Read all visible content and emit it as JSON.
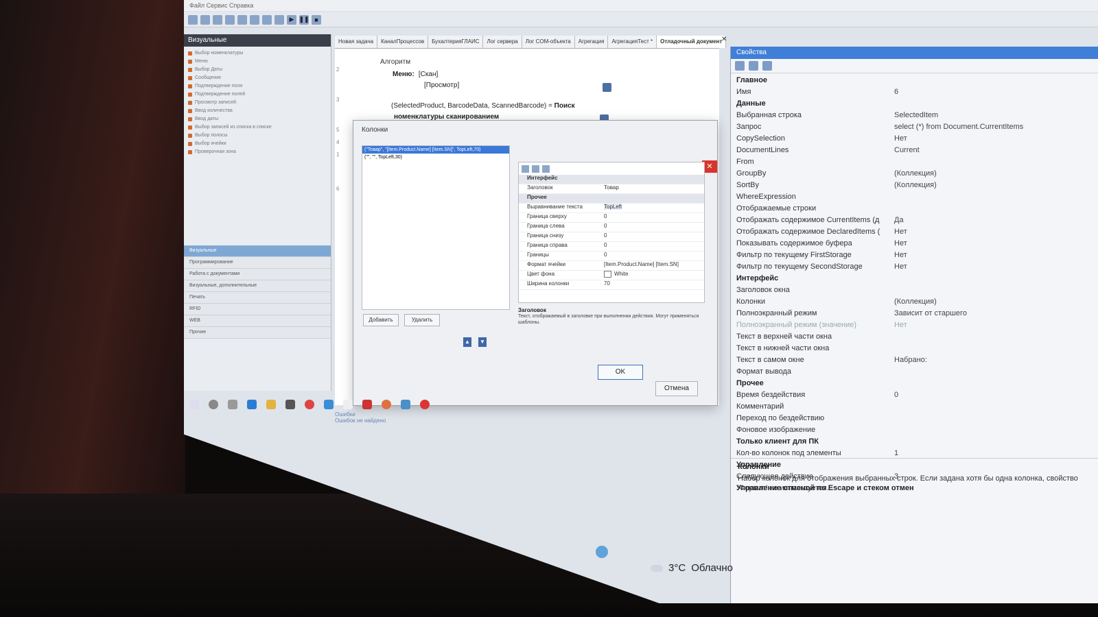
{
  "window": {
    "title": "Файл  Сервис  Справка"
  },
  "left_panel": {
    "header": "Визуальные",
    "items": [
      "Выбор номенклатуры",
      "Меню",
      "Выбор Даты",
      "Сообщение",
      "Подтверждение поля",
      "Подтверждение полей",
      "Просмотр записей",
      "Ввод количества",
      "Ввод даты",
      "Выбор записей из списка в списке",
      "Выбор полосы",
      "Выбор ячейки",
      "Проверочная зона"
    ],
    "sections": [
      "Визуальные",
      "Программирование",
      "Работа с документами",
      "Визуальные, дополнительные",
      "Печать",
      "RFID",
      "WEB",
      "Прочие"
    ]
  },
  "tabs": [
    "Новая задача",
    "КаналПроцессов",
    "БухалтерияГЛАИС",
    "Лог сервера",
    "Лог COM-объекта",
    "Агрегация",
    "АгрегацияТест *",
    "Отладочный документ"
  ],
  "editor": {
    "lines": [
      "2",
      "3",
      "5",
      "4",
      "1",
      "6"
    ],
    "algo": "Алгоритм",
    "menu_label": "Меню:",
    "menu_value1": "[Скан]",
    "menu_value2": "[Просмотр]",
    "assign_expr": "(SelectedProduct, BarcodeData, ScannedBarcode) =",
    "assign_op": "Поиск",
    "assign_line2": "номенклатуры сканированием"
  },
  "errors": {
    "title": "Ошибки",
    "line": "Ошибок не найдено"
  },
  "dialog": {
    "title": "Колонки",
    "list_items": [
      "(\"Товар\", \"[Item.Product.Name] [Item.SN]\", TopLeft,70)",
      "(\"\", \"\", TopLeft,30)"
    ],
    "add_label": "Добавить",
    "remove_label": "Удалить",
    "grid": {
      "rows": [
        {
          "k": "Интерфейс",
          "v": "",
          "cat": true
        },
        {
          "k": "Заголовок",
          "v": "Товар",
          "cat": false
        },
        {
          "k": "Прочее",
          "v": "",
          "cat": true
        },
        {
          "k": "Выравнивание текста",
          "v": "TopLeft",
          "cat": false
        },
        {
          "k": "Граница сверху",
          "v": "0",
          "cat": false
        },
        {
          "k": "Граница слева",
          "v": "0",
          "cat": false
        },
        {
          "k": "Граница снизу",
          "v": "0",
          "cat": false
        },
        {
          "k": "Граница справа",
          "v": "0",
          "cat": false
        },
        {
          "k": "Границы",
          "v": "0",
          "cat": false
        },
        {
          "k": "Формат ячейки",
          "v": "[Item.Product.Name] [Item.SN]",
          "cat": false
        },
        {
          "k": "Цвет фона",
          "v": "White",
          "cat": false
        },
        {
          "k": "Ширина колонки",
          "v": "70",
          "cat": false
        }
      ]
    },
    "desc_title": "Заголовок",
    "desc_text": "Текст, отображаемый в заголовке при выполнении действия. Могут применяться шаблоны.",
    "ok": "OK",
    "cancel": "Отмена"
  },
  "properties": {
    "title": "Свойства",
    "rows": [
      {
        "k": "Главное",
        "v": "",
        "cat": true
      },
      {
        "k": "Имя",
        "v": "6",
        "cat": false
      },
      {
        "k": "Данные",
        "v": "",
        "cat": true
      },
      {
        "k": "Выбранная строка",
        "v": "SelectedItem",
        "cat": false
      },
      {
        "k": "Запрос",
        "v": "select (*) from Document.CurrentItems",
        "cat": false
      },
      {
        "k": "CopySelection",
        "v": "Нет",
        "cat": false
      },
      {
        "k": "DocumentLines",
        "v": "Current",
        "cat": false
      },
      {
        "k": "From",
        "v": "",
        "cat": false
      },
      {
        "k": "GroupBy",
        "v": "(Коллекция)",
        "cat": false
      },
      {
        "k": "SortBy",
        "v": "(Коллекция)",
        "cat": false
      },
      {
        "k": "WhereExpression",
        "v": "",
        "cat": false
      },
      {
        "k": "Отображаемые строки",
        "v": "",
        "cat": false
      },
      {
        "k": "Отображать содержимое CurrentItems (д",
        "v": "Да",
        "cat": false
      },
      {
        "k": "Отображать содержимое DeclaredItems (",
        "v": "Нет",
        "cat": false
      },
      {
        "k": "Показывать содержимое буфера",
        "v": "Нет",
        "cat": false
      },
      {
        "k": "Фильтр по текущему FirstStorage",
        "v": "Нет",
        "cat": false
      },
      {
        "k": "Фильтр по текущему SecondStorage",
        "v": "Нет",
        "cat": false
      },
      {
        "k": "Интерфейс",
        "v": "",
        "cat": true
      },
      {
        "k": "Заголовок окна",
        "v": "",
        "cat": false
      },
      {
        "k": "Колонки",
        "v": "(Коллекция)",
        "cat": false
      },
      {
        "k": "Полноэкранный режим",
        "v": "Зависит от старшего",
        "cat": false
      },
      {
        "k": "Полноэкранный режим (значение)",
        "v": "Нет",
        "cat": false,
        "muted": true
      },
      {
        "k": "Текст в верхней части окна",
        "v": "",
        "cat": false
      },
      {
        "k": "Текст в нижней части окна",
        "v": "",
        "cat": false
      },
      {
        "k": "Текст в самом окне",
        "v": "Набрано:",
        "cat": false
      },
      {
        "k": "Формат вывода",
        "v": "",
        "cat": false
      },
      {
        "k": "Прочее",
        "v": "",
        "cat": true
      },
      {
        "k": "Время бездействия",
        "v": "0",
        "cat": false
      },
      {
        "k": "Комментарий",
        "v": "",
        "cat": false
      },
      {
        "k": "Переход по бездействию",
        "v": "",
        "cat": false
      },
      {
        "k": "Фоновое изображение",
        "v": "",
        "cat": false
      },
      {
        "k": "Только клиент для ПК",
        "v": "",
        "cat": true
      },
      {
        "k": "Кол-во колонок под элементы",
        "v": "1",
        "cat": false
      },
      {
        "k": "Управление",
        "v": "",
        "cat": true
      },
      {
        "k": "Следующее действие",
        "v": "3",
        "cat": false
      },
      {
        "k": "Управление отменой по Escape и стеком отмен",
        "v": "",
        "cat": true
      }
    ],
    "desc_title": "Колонки",
    "desc_text": "Набор колонок для отображения выбранных строк. Если задана хотя бы одна колонка, свойство 'Формат' не используется."
  },
  "weather": {
    "temp": "3°C",
    "text": "Облачно"
  }
}
